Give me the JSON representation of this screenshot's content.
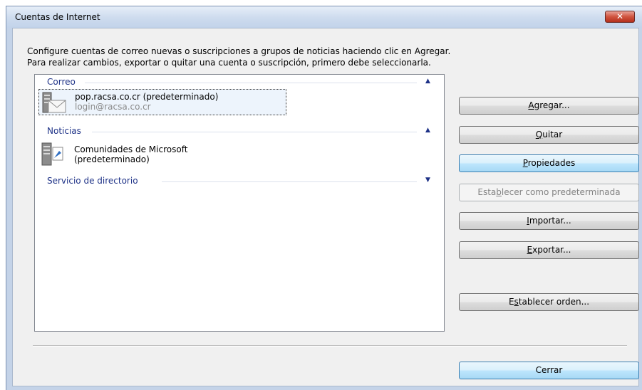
{
  "window": {
    "title": "Cuentas de Internet",
    "close_glyph": "✕"
  },
  "instructions": {
    "line1": "Configure cuentas de correo nuevas o suscripciones a grupos de noticias haciendo clic en Agregar.",
    "line2": "Para realizar cambios, exportar o quitar una cuenta o suscripción, primero debe seleccionarla."
  },
  "groups": {
    "mail": {
      "label": "Correo",
      "expanded": true
    },
    "news": {
      "label": "Noticias",
      "expanded": true
    },
    "directory": {
      "label": "Servicio de directorio",
      "expanded": false
    }
  },
  "accounts": {
    "mail": {
      "name": "pop.racsa.co.cr (predeterminado)",
      "login": "login@racsa.co.cr",
      "icon": "mail-server-icon"
    },
    "news": {
      "line1": "Comunidades de Microsoft",
      "line2": "(predeterminado)",
      "icon": "news-server-icon"
    }
  },
  "buttons": {
    "add": {
      "label": "Agregar...",
      "accel": "A"
    },
    "remove": {
      "label": "Quitar",
      "accel": "Q"
    },
    "properties": {
      "label": "Propiedades",
      "accel": "P"
    },
    "set_default": {
      "label": "Establecer como predeterminada",
      "accel": "b",
      "disabled": true
    },
    "import": {
      "label": "Importar...",
      "accel": "I"
    },
    "export": {
      "label": "Exportar...",
      "accel": "E"
    },
    "set_order": {
      "label": "Establecer orden...",
      "accel": "s"
    },
    "close": {
      "label": "Cerrar"
    }
  },
  "colors": {
    "group_header": "#1e3287",
    "focus_border": "#3c7fb1",
    "close_red": "#c84531"
  }
}
